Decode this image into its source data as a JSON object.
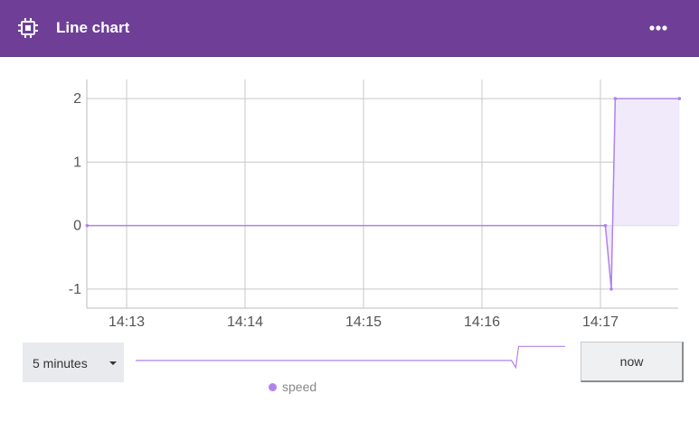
{
  "header": {
    "title": "Line chart",
    "icon": "chip-icon",
    "menu_icon": "more-horizontal-icon"
  },
  "colors": {
    "header_bg": "#6f3f98",
    "series": "#b083ea",
    "area_fill": "#f1eafb"
  },
  "chart_data": {
    "type": "line",
    "title": "",
    "xlabel": "",
    "ylabel": "",
    "x_ticks": [
      "14:13",
      "14:14",
      "14:15",
      "14:16",
      "14:17"
    ],
    "y_ticks": [
      "-1",
      "0",
      "1",
      "2"
    ],
    "ylim": [
      -1.3,
      2.3
    ],
    "grid": true,
    "legend": "bottom",
    "series": [
      {
        "name": "speed",
        "x": [
          "14:12:40",
          "14:17:02.5",
          "14:17:05.5",
          "14:17:07.5",
          "14:17:40"
        ],
        "y": [
          0,
          0,
          -1,
          2,
          2
        ]
      }
    ]
  },
  "controls": {
    "range_label": "5 minutes",
    "range_options": [
      "5 minutes"
    ],
    "now_label": "now"
  }
}
